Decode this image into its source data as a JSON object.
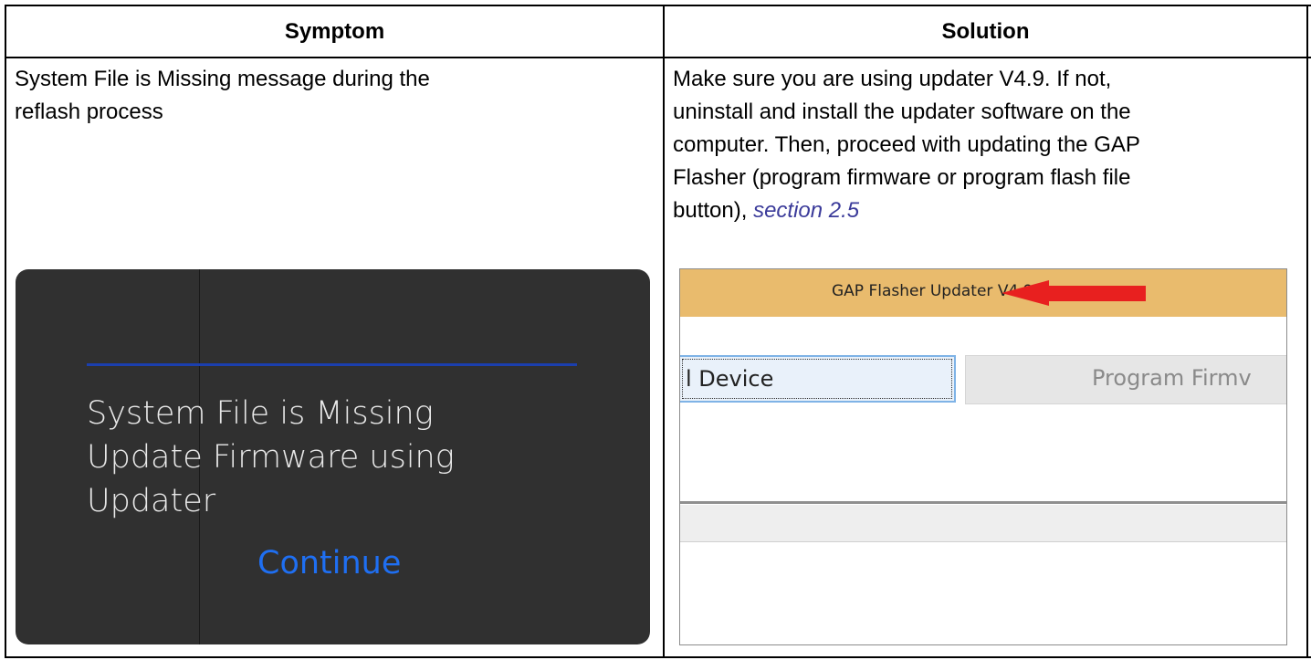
{
  "table": {
    "headers": [
      "Symptom",
      "Solution"
    ],
    "row": {
      "symptom_lines": [
        "System File is Missing message during the",
        "reflash process"
      ],
      "solution_lines": [
        "Make sure you are using updater V4.9. If not,",
        "uninstall and install the updater software on the",
        "computer. Then, proceed with updating the GAP",
        "Flasher (program firmware or program flash file"
      ],
      "solution_last_prefix": "button), ",
      "solution_link": "section 2.5"
    }
  },
  "device_screen": {
    "message_lines": [
      "System File is Missing",
      "Update Firmware using",
      "Updater"
    ],
    "continue_label": "Continue",
    "rule_color": "#1b3fae",
    "continue_color": "#1f6ff2"
  },
  "updater_window": {
    "title": "GAP Flasher Updater V4.9",
    "button_device_label": "l Device",
    "button_program_label": "Program Firmv",
    "title_bar_color": "#e9bb6d",
    "arrow_color": "#e8201f",
    "arrow_icon": "arrow-left-icon"
  }
}
